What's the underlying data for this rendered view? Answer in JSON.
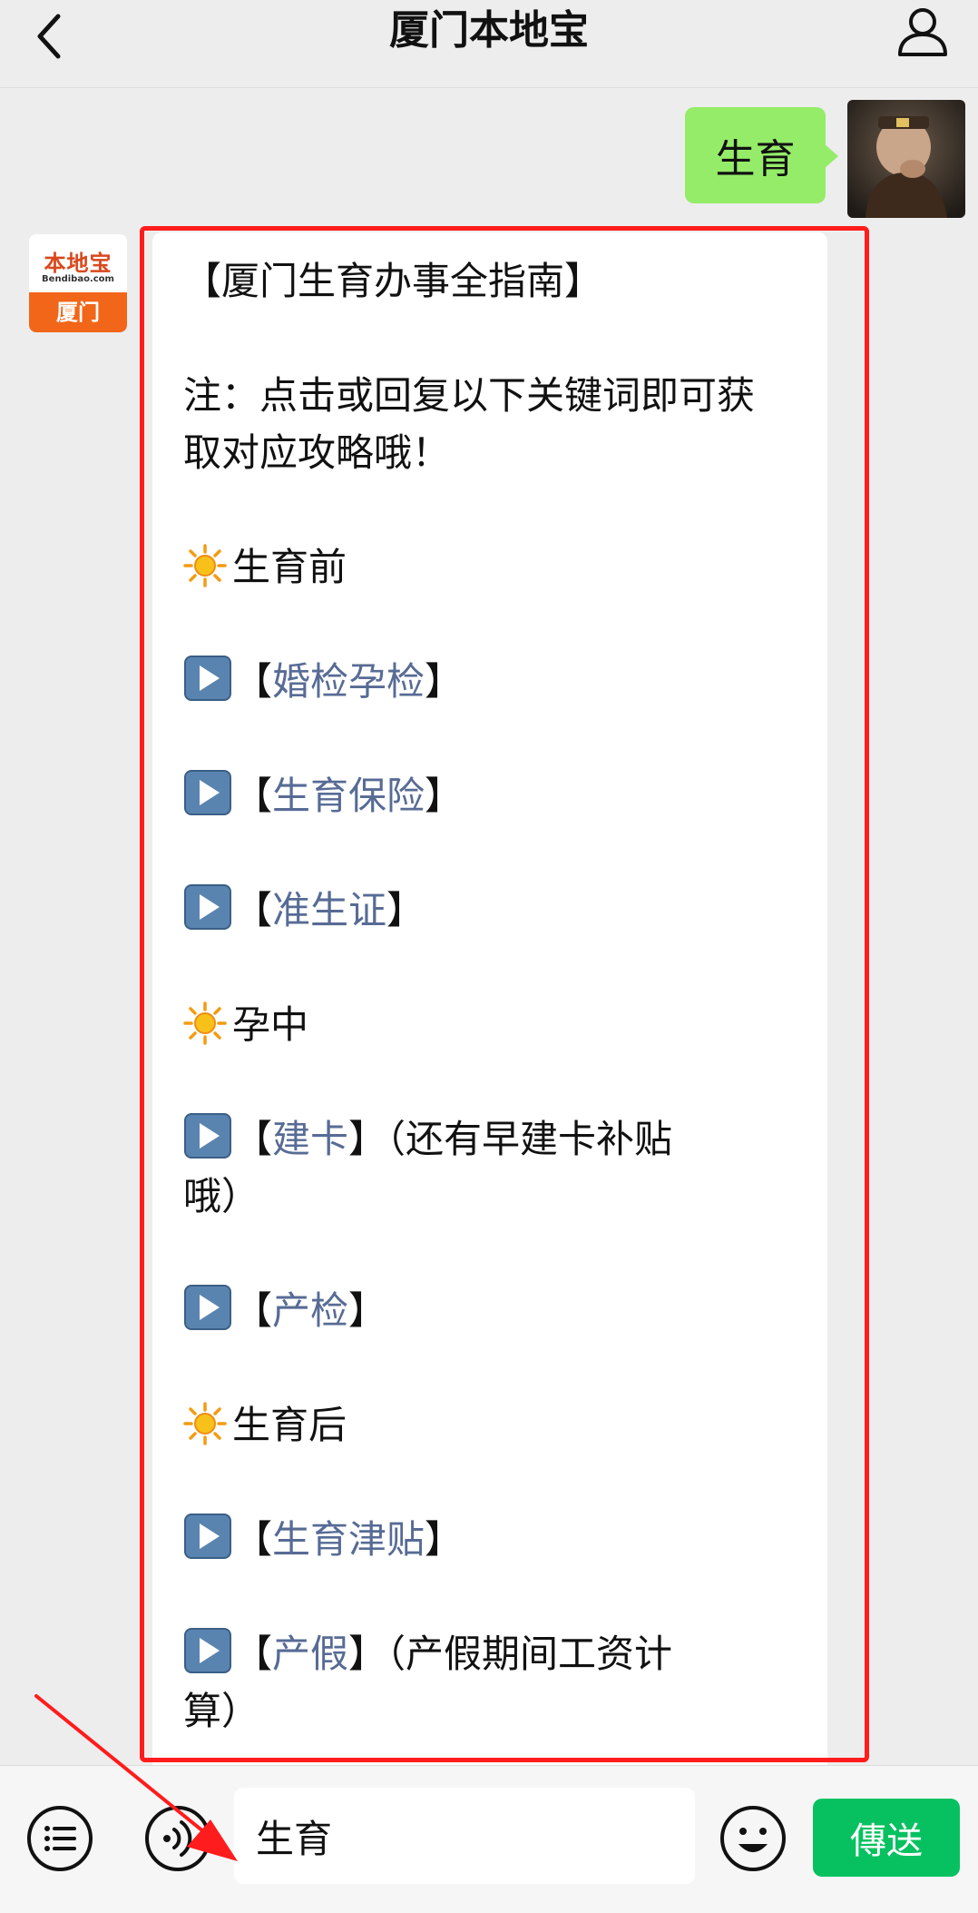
{
  "header": {
    "title": "厦门本地宝"
  },
  "outgoing": {
    "text": "生育"
  },
  "bot_avatar": {
    "name": "本地宝",
    "url": "Bendibao.com",
    "city": "厦门"
  },
  "message": {
    "heading": "【厦门生育办事全指南】",
    "note_line1": "注：点击或回复以下关键词即可获",
    "note_line2": "取对应攻略哦！",
    "section_before": "生育前",
    "link_1": "婚检孕检",
    "link_2": "生育保险",
    "link_3": "准生证",
    "section_during": "孕中",
    "link_4": "建卡",
    "link_4_suffix_a": "（还有早建卡补贴",
    "link_4_suffix_b": "哦）",
    "link_5": "产检",
    "section_after": "生育后",
    "link_6": "生育津贴",
    "link_7": "产假",
    "link_7_suffix_a": "（产假期间工资计",
    "link_7_suffix_b": "算）",
    "bracket_open": "【",
    "bracket_close": "】"
  },
  "input_bar": {
    "input_value": "生育",
    "send_label": "傳送"
  },
  "colors": {
    "outgoing_bubble": "#95ec69",
    "link": "#576b95",
    "send_button": "#07c160",
    "highlight": "#ff1c1c"
  }
}
